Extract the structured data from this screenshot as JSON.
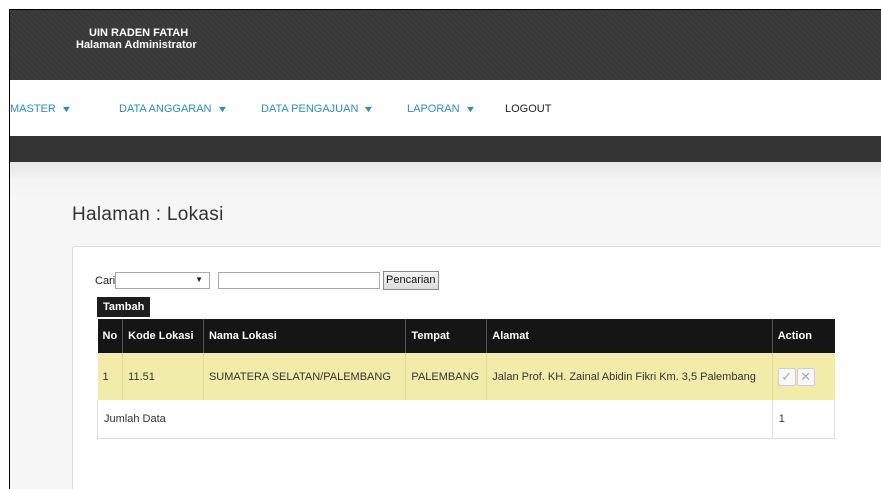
{
  "header": {
    "line1": "UIN RADEN FATAH",
    "line2": "Halaman Administrator"
  },
  "nav": {
    "items": [
      {
        "label": "MASTER"
      },
      {
        "label": "DATA ANGGARAN"
      },
      {
        "label": "DATA PENGAJUAN"
      },
      {
        "label": "LAPORAN"
      },
      {
        "label": "LOGOUT"
      }
    ],
    "chevron": "▼"
  },
  "page": {
    "title": "Halaman : Lokasi"
  },
  "search": {
    "label": "Cari",
    "select_value": "",
    "input_value": "",
    "button_label": "Pencarian"
  },
  "add_button_label": "Tambah",
  "table": {
    "columns": [
      "No",
      "Kode Lokasi",
      "Nama Lokasi",
      "Tempat",
      "Alamat",
      "Action"
    ],
    "rows": [
      {
        "no": "1",
        "kode": "11.51",
        "nama": "SUMATERA SELATAN/PALEMBANG",
        "tempat": "PALEMBANG",
        "alamat": "Jalan Prof. KH. Zainal Abidin Fikri Km. 3,5 Palembang"
      }
    ],
    "footer_label": "Jumlah Data",
    "footer_count": "1"
  },
  "colors": {
    "nav_link": "#2b8ec9",
    "row_highlight": "#f2ecaa",
    "header_dark": "#151515"
  },
  "icons": {
    "edit": "check-icon",
    "delete": "close-icon"
  }
}
